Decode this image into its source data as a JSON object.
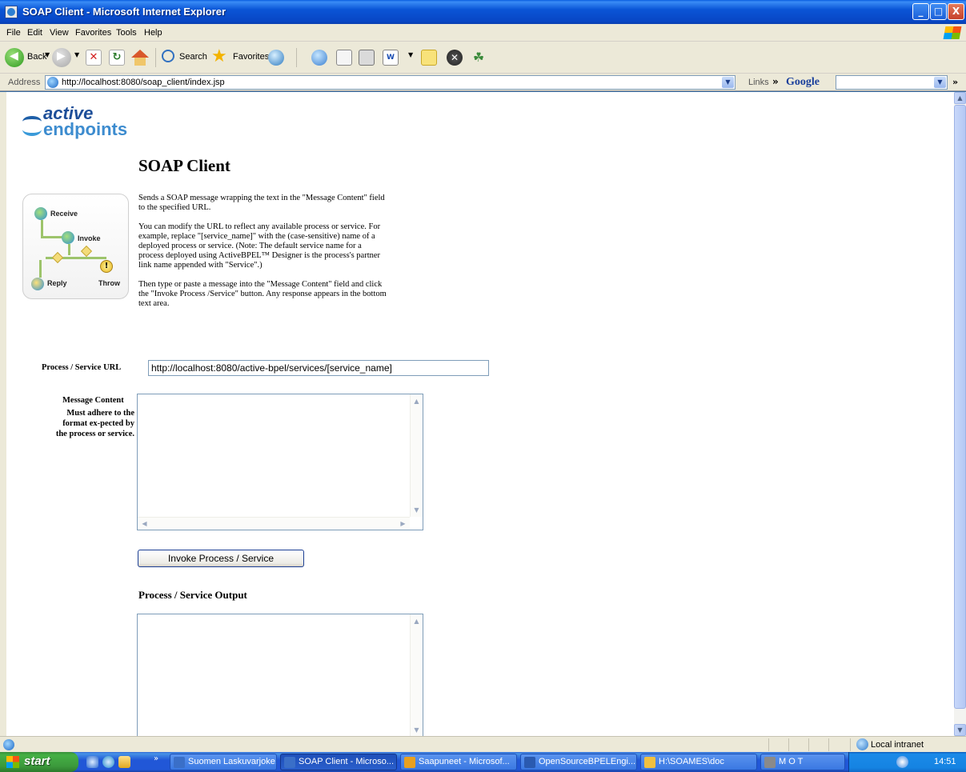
{
  "window": {
    "title": "SOAP Client - Microsoft Internet Explorer",
    "minimize": "_",
    "maximize": "□",
    "close": "X"
  },
  "menubar": {
    "items": [
      "File",
      "Edit",
      "View",
      "Favorites",
      "Tools",
      "Help"
    ]
  },
  "toolbar": {
    "back_label": "Back",
    "search_label": "Search",
    "favorites_label": "Favorites",
    "word_label": "W"
  },
  "addressbar": {
    "label": "Address",
    "url": "http://localhost:8080/soap_client/index.jsp",
    "links_label": "Links",
    "google_label": "Google"
  },
  "page": {
    "logo_line1": "active",
    "logo_line2": "endpoints",
    "title": "SOAP Client",
    "diagram": {
      "receive": "Receive",
      "invoke": "Invoke",
      "reply": "Reply",
      "throw": "Throw",
      "throw_symbol": "!"
    },
    "description": [
      "Sends a SOAP message wrapping the text in the \"Message Content\" field to the specified URL.",
      "You can modify the URL to reflect any available process or service. For example, replace \"[service_name]\" with the (case-sensitive) name of a deployed process or service. (Note: The default service name for a process deployed using ActiveBPEL™ Designer is the process's partner link name appended with \"Service\".)",
      "Then type or paste a message into the \"Message Content\" field and click the \"Invoke Process /Service\" button. Any response appears in the bottom text area."
    ],
    "url_label": "Process / Service URL",
    "url_value": "http://localhost:8080/active-bpel/services/[service_name]",
    "message_label": "Message Content",
    "message_note": "Must adhere to the format ex-pected by the process or service.",
    "message_value": "",
    "invoke_button": "Invoke Process / Service",
    "output_title": "Process / Service Output",
    "output_value": ""
  },
  "statusbar": {
    "zone": "Local intranet"
  },
  "taskbar": {
    "start": "start",
    "tasks": [
      {
        "label": "Suomen Laskuvarjoke...",
        "color": "#3a6fc8"
      },
      {
        "label": "SOAP Client - Microso...",
        "color": "#3a6fc8"
      },
      {
        "label": "Saapuneet - Microsof...",
        "color": "#e8a020"
      },
      {
        "label": "OpenSourceBPELEngi...",
        "color": "#2a5ab0"
      },
      {
        "label": "H:\\SOAMES\\doc",
        "color": "#f0c040"
      },
      {
        "label": "M O T",
        "color": "#8a8a8a"
      }
    ],
    "clock": "14:51"
  }
}
